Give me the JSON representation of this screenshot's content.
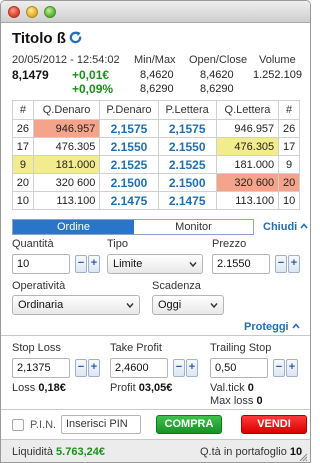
{
  "header": {
    "title": "Titolo ß",
    "datetime": "20/05/2012 - 12:54:02",
    "price": "8,1479",
    "minmax_label": "Min/Max",
    "openclose_label": "Open/Close",
    "volume_label": "Volume",
    "change_abs": "+0,01€",
    "change_pct": "+0,09%",
    "min": "8,4620",
    "max": "8,6290",
    "open": "8,4620",
    "close": "8,6290",
    "volume": "1.252.109"
  },
  "book": {
    "columns": [
      "#",
      "Q.Denaro",
      "P.Denaro",
      "P.Lettera",
      "Q.Lettera",
      "#"
    ],
    "rows": [
      {
        "n_bid": "26",
        "q_bid": "946.957",
        "p_bid": "2,1575",
        "p_ask": "2,1575",
        "q_ask": "946.957",
        "n_ask": "26",
        "hl_bid": "red",
        "hl_ask": ""
      },
      {
        "n_bid": "17",
        "q_bid": "476.305",
        "p_bid": "2.1550",
        "p_ask": "2.1550",
        "q_ask": "476.305",
        "n_ask": "17",
        "hl_bid": "",
        "hl_ask": "yel"
      },
      {
        "n_bid": "9",
        "q_bid": "181.000",
        "p_bid": "2.1525",
        "p_ask": "2.1525",
        "q_ask": "181.000",
        "n_ask": "9",
        "hl_bid": "yel",
        "hl_ask": ""
      },
      {
        "n_bid": "20",
        "q_bid": "320 600",
        "p_bid": "2.1500",
        "p_ask": "2.1500",
        "q_ask": "320 600",
        "n_ask": "20",
        "hl_bid": "",
        "hl_ask": "red"
      },
      {
        "n_bid": "10",
        "q_bid": "113.100",
        "p_bid": "2.1475",
        "p_ask": "2.1475",
        "q_ask": "113.100",
        "n_ask": "10",
        "hl_bid": "",
        "hl_ask": ""
      }
    ]
  },
  "tabs": {
    "ordine": "Ordine",
    "monitor": "Monitor",
    "chiudi": "Chiudi"
  },
  "order": {
    "quantita_label": "Quantità",
    "quantita_value": "10",
    "tipo_label": "Tipo",
    "tipo_value": "Limite",
    "prezzo_label": "Prezzo",
    "prezzo_value": "2.1550",
    "operativita_label": "Operatività",
    "operativita_value": "Ordinaria",
    "scadenza_label": "Scadenza",
    "scadenza_value": "Oggi",
    "proteggi": "Proteggi"
  },
  "protection": {
    "stop_loss_label": "Stop Loss",
    "stop_loss_value": "2,1375",
    "loss_label": "Loss",
    "loss_value": "0,18€",
    "take_profit_label": "Take Profit",
    "take_profit_value": "2,4600",
    "profit_label": "Profit",
    "profit_value": "03,05€",
    "trailing_label": "Trailing Stop",
    "trailing_value": "0,50",
    "valtick_label": "Val.tick",
    "valtick_value": "0",
    "maxloss_label": "Max loss",
    "maxloss_value": "0"
  },
  "actions": {
    "pin_label": "P.I.N.",
    "pin_placeholder": "Inserisci PIN",
    "buy": "COMPRA",
    "sell": "VENDI"
  },
  "footer": {
    "liquidita_label": "Liquidità",
    "liquidita_value": "5.763,24€",
    "portafoglio_label": "Q.tà in portafoglio",
    "portafoglio_value": "10"
  },
  "colors": {
    "accent_blue": "#1f6fb5",
    "positive_green": "#1b8f1b",
    "buy_green": "#169226",
    "sell_red": "#d80000",
    "highlight_red": "#f4a48a",
    "highlight_yellow": "#f3ec8e"
  }
}
